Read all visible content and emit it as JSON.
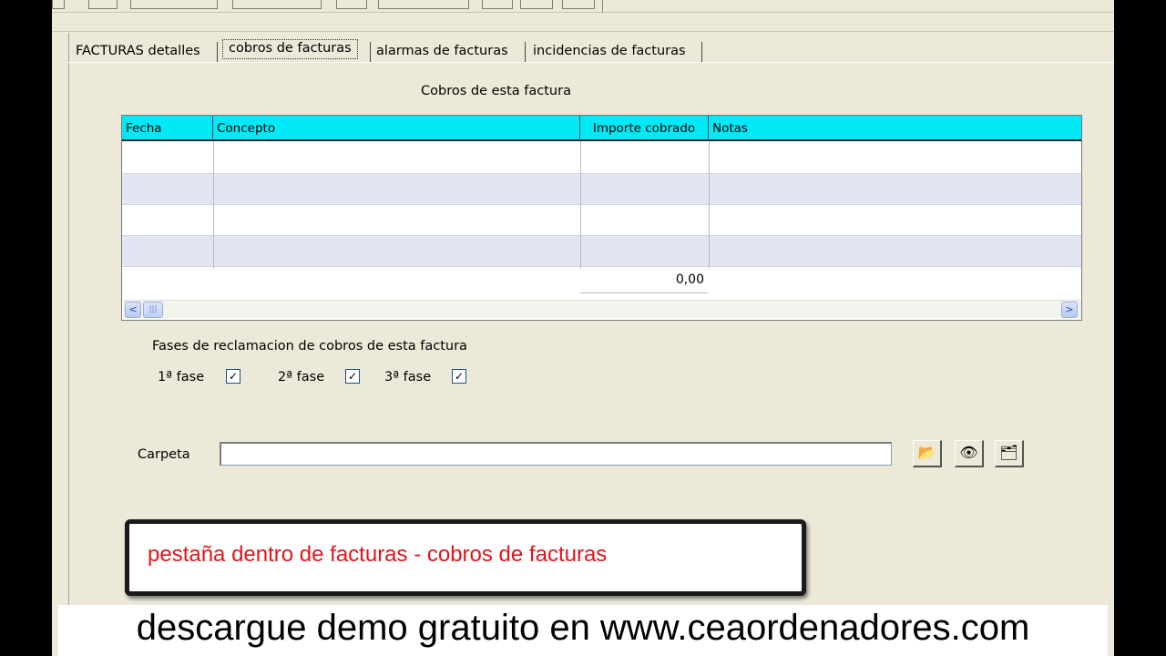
{
  "tabs": [
    {
      "label": "FACTURAS detalles"
    },
    {
      "label": "cobros de facturas"
    },
    {
      "label": "alarmas de facturas"
    },
    {
      "label": "incidencias de facturas"
    }
  ],
  "section_title": "Cobros de esta factura",
  "grid": {
    "columns": [
      "Fecha",
      "Concepto",
      "Importe cobrado",
      "Notas"
    ],
    "rows": [
      {
        "fecha": "",
        "concepto": "",
        "importe": "",
        "notas": ""
      },
      {
        "fecha": "",
        "concepto": "",
        "importe": "",
        "notas": ""
      },
      {
        "fecha": "",
        "concepto": "",
        "importe": "",
        "notas": ""
      },
      {
        "fecha": "",
        "concepto": "",
        "importe": "",
        "notas": ""
      }
    ],
    "total": "0,00",
    "scroll_left": "<",
    "scroll_right": ">"
  },
  "phases": {
    "title": "Fases de reclamacion de cobros de esta factura",
    "items": [
      {
        "label": "1ª fase",
        "checked": true,
        "mark": "✓"
      },
      {
        "label": "2ª fase",
        "checked": true,
        "mark": "✓"
      },
      {
        "label": "3ª fase",
        "checked": true,
        "mark": "✓"
      }
    ]
  },
  "folder": {
    "label": "Carpeta",
    "value": "",
    "buttons": [
      {
        "icon": "folder-open-icon",
        "glyph": "📂"
      },
      {
        "icon": "eye-icon",
        "glyph": "👁"
      },
      {
        "icon": "folder-tree-icon",
        "glyph": "🗂"
      }
    ]
  },
  "callout": {
    "text": "pestaña dentro de facturas - cobros de facturas",
    "color": "#e4141b"
  },
  "banner": {
    "text": "descargue demo gratuito en www.ceaordenadores.com"
  },
  "colors": {
    "grid_header": "#00e9f6",
    "window_bg": "#ece9d8",
    "alt_row": "#e3e6f2"
  }
}
